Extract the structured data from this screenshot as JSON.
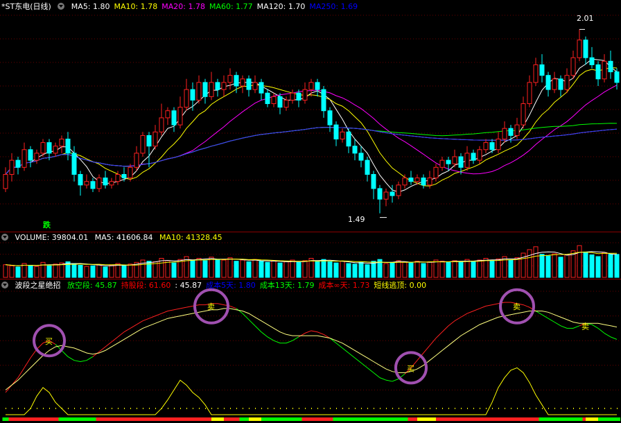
{
  "price_panel": {
    "stock_name": "*ST东电",
    "period": "(日线)",
    "ma_labels": [
      {
        "label": "MA5: 1.80",
        "color": "#ffffff"
      },
      {
        "label": "MA10: 1.78",
        "color": "#ffff00"
      },
      {
        "label": "MA20: 1.78",
        "color": "#ff00ff"
      },
      {
        "label": "MA60: 1.77",
        "color": "#00ff00"
      },
      {
        "label": "MA120: 1.70",
        "color": "#ffffff"
      },
      {
        "label": "MA250: 1.69",
        "color": "#0000ff"
      }
    ],
    "high_label": "2.01",
    "low_label": "1.49",
    "signal_label": "跌"
  },
  "volume_panel": {
    "title": "VOLUME: 39804.01",
    "ma5": "MA5: 41606.84",
    "ma10": "MA10: 41328.45"
  },
  "indicator_panel": {
    "title": "波段之星绝招",
    "items": [
      {
        "label": "放空段: 45.87",
        "color": "#00ff00"
      },
      {
        "label": "持股段: 61.60",
        "color": "#ff0000"
      },
      {
        "label": ": 45.87",
        "color": "#ffffff"
      },
      {
        "label": "成本5天: 1.80",
        "color": "#0000ff"
      },
      {
        "label": "成本13天: 1.79",
        "color": "#00ff00"
      },
      {
        "label": "成本∞天: 1.73",
        "color": "#ff0000"
      },
      {
        "label": "短线逃顶: 0.00",
        "color": "#ffff00"
      }
    ],
    "buy_label": "买",
    "sell_label": "卖"
  },
  "chart_data": {
    "type": "candlestick",
    "ylim": [
      1.45,
      2.05
    ],
    "candles": [
      [
        1.56,
        1.6,
        1.55,
        1.62
      ],
      [
        1.6,
        1.64,
        1.58,
        1.66
      ],
      [
        1.64,
        1.62,
        1.6,
        1.65
      ],
      [
        1.62,
        1.67,
        1.61,
        1.69
      ],
      [
        1.67,
        1.64,
        1.62,
        1.68
      ],
      [
        1.64,
        1.66,
        1.63,
        1.67
      ],
      [
        1.66,
        1.69,
        1.65,
        1.7
      ],
      [
        1.69,
        1.66,
        1.64,
        1.7
      ],
      [
        1.66,
        1.68,
        1.65,
        1.69
      ],
      [
        1.68,
        1.7,
        1.66,
        1.71
      ],
      [
        1.7,
        1.66,
        1.64,
        1.72
      ],
      [
        1.66,
        1.6,
        1.58,
        1.68
      ],
      [
        1.6,
        1.57,
        1.54,
        1.61
      ],
      [
        1.57,
        1.58,
        1.56,
        1.6
      ],
      [
        1.58,
        1.56,
        1.55,
        1.59
      ],
      [
        1.56,
        1.59,
        1.55,
        1.6
      ],
      [
        1.59,
        1.57,
        1.56,
        1.61
      ],
      [
        1.57,
        1.58,
        1.56,
        1.59
      ],
      [
        1.58,
        1.6,
        1.57,
        1.61
      ],
      [
        1.6,
        1.59,
        1.58,
        1.62
      ],
      [
        1.59,
        1.62,
        1.58,
        1.63
      ],
      [
        1.62,
        1.66,
        1.61,
        1.68
      ],
      [
        1.66,
        1.71,
        1.65,
        1.72
      ],
      [
        1.71,
        1.68,
        1.62,
        1.72
      ],
      [
        1.68,
        1.72,
        1.67,
        1.74
      ],
      [
        1.72,
        1.76,
        1.71,
        1.8
      ],
      [
        1.76,
        1.78,
        1.74,
        1.79
      ],
      [
        1.78,
        1.74,
        1.72,
        1.79
      ],
      [
        1.74,
        1.79,
        1.73,
        1.82
      ],
      [
        1.79,
        1.84,
        1.78,
        1.87
      ],
      [
        1.84,
        1.81,
        1.78,
        1.86
      ],
      [
        1.81,
        1.86,
        1.8,
        1.88
      ],
      [
        1.86,
        1.82,
        1.8,
        1.87
      ],
      [
        1.82,
        1.86,
        1.81,
        1.89
      ],
      [
        1.86,
        1.84,
        1.82,
        1.87
      ],
      [
        1.84,
        1.86,
        1.82,
        1.88
      ],
      [
        1.86,
        1.88,
        1.84,
        1.9
      ],
      [
        1.88,
        1.85,
        1.83,
        1.89
      ],
      [
        1.85,
        1.87,
        1.83,
        1.88
      ],
      [
        1.87,
        1.84,
        1.82,
        1.88
      ],
      [
        1.84,
        1.86,
        1.83,
        1.88
      ],
      [
        1.86,
        1.83,
        1.81,
        1.87
      ],
      [
        1.83,
        1.8,
        1.79,
        1.84
      ],
      [
        1.8,
        1.82,
        1.79,
        1.83
      ],
      [
        1.82,
        1.79,
        1.77,
        1.83
      ],
      [
        1.79,
        1.81,
        1.78,
        1.82
      ],
      [
        1.81,
        1.83,
        1.8,
        1.84
      ],
      [
        1.83,
        1.81,
        1.79,
        1.84
      ],
      [
        1.81,
        1.84,
        1.8,
        1.86
      ],
      [
        1.84,
        1.86,
        1.82,
        1.87
      ],
      [
        1.86,
        1.84,
        1.82,
        1.87
      ],
      [
        1.84,
        1.78,
        1.76,
        1.85
      ],
      [
        1.78,
        1.74,
        1.72,
        1.79
      ],
      [
        1.74,
        1.7,
        1.68,
        1.75
      ],
      [
        1.7,
        1.72,
        1.69,
        1.73
      ],
      [
        1.72,
        1.68,
        1.66,
        1.73
      ],
      [
        1.68,
        1.66,
        1.64,
        1.7
      ],
      [
        1.66,
        1.64,
        1.62,
        1.68
      ],
      [
        1.64,
        1.6,
        1.58,
        1.65
      ],
      [
        1.6,
        1.56,
        1.53,
        1.61
      ],
      [
        1.56,
        1.53,
        1.49,
        1.57
      ],
      [
        1.53,
        1.55,
        1.51,
        1.56
      ],
      [
        1.55,
        1.54,
        1.52,
        1.57
      ],
      [
        1.54,
        1.57,
        1.53,
        1.58
      ],
      [
        1.57,
        1.59,
        1.56,
        1.6
      ],
      [
        1.59,
        1.58,
        1.57,
        1.61
      ],
      [
        1.58,
        1.59,
        1.57,
        1.6
      ],
      [
        1.59,
        1.57,
        1.56,
        1.6
      ],
      [
        1.57,
        1.59,
        1.56,
        1.61
      ],
      [
        1.59,
        1.62,
        1.58,
        1.63
      ],
      [
        1.62,
        1.64,
        1.61,
        1.65
      ],
      [
        1.64,
        1.63,
        1.61,
        1.65
      ],
      [
        1.63,
        1.65,
        1.62,
        1.67
      ],
      [
        1.65,
        1.62,
        1.6,
        1.66
      ],
      [
        1.62,
        1.66,
        1.61,
        1.68
      ],
      [
        1.66,
        1.64,
        1.63,
        1.67
      ],
      [
        1.64,
        1.67,
        1.63,
        1.68
      ],
      [
        1.67,
        1.69,
        1.66,
        1.7
      ],
      [
        1.69,
        1.67,
        1.66,
        1.7
      ],
      [
        1.67,
        1.7,
        1.66,
        1.72
      ],
      [
        1.7,
        1.73,
        1.69,
        1.75
      ],
      [
        1.73,
        1.71,
        1.69,
        1.74
      ],
      [
        1.71,
        1.74,
        1.7,
        1.76
      ],
      [
        1.74,
        1.8,
        1.73,
        1.82
      ],
      [
        1.8,
        1.86,
        1.79,
        1.88
      ],
      [
        1.86,
        1.91,
        1.85,
        1.93
      ],
      [
        1.91,
        1.88,
        1.86,
        1.94
      ],
      [
        1.88,
        1.84,
        1.82,
        1.89
      ],
      [
        1.84,
        1.87,
        1.83,
        1.89
      ],
      [
        1.87,
        1.84,
        1.82,
        1.88
      ],
      [
        1.84,
        1.88,
        1.83,
        1.9
      ],
      [
        1.88,
        1.93,
        1.87,
        1.95
      ],
      [
        1.93,
        1.98,
        1.92,
        2.01
      ],
      [
        1.98,
        1.93,
        1.91,
        1.99
      ],
      [
        1.93,
        1.91,
        1.9,
        1.96
      ],
      [
        1.91,
        1.87,
        1.85,
        1.92
      ],
      [
        1.87,
        1.92,
        1.86,
        1.94
      ],
      [
        1.92,
        1.89,
        1.87,
        1.95
      ],
      [
        1.89,
        1.86,
        1.84,
        1.9
      ]
    ],
    "volume_ylim": [
      0,
      60000
    ],
    "volume": [
      22000,
      20000,
      18000,
      24000,
      21000,
      19000,
      26000,
      20000,
      23000,
      25000,
      27000,
      24000,
      21000,
      19000,
      20000,
      22000,
      18000,
      21000,
      24000,
      20000,
      23000,
      26000,
      30000,
      28000,
      27000,
      33000,
      29000,
      25000,
      31000,
      36000,
      30000,
      33000,
      29000,
      35000,
      31000,
      30000,
      34000,
      28000,
      30000,
      27000,
      31000,
      28000,
      26000,
      29000,
      25000,
      27000,
      30000,
      26000,
      29000,
      33000,
      28000,
      31000,
      27000,
      25000,
      28000,
      24000,
      23000,
      26000,
      22000,
      28000,
      31000,
      24000,
      26000,
      29000,
      27000,
      25000,
      28000,
      24000,
      27000,
      30000,
      28000,
      26000,
      29000,
      27000,
      31000,
      28000,
      30000,
      33000,
      29000,
      32000,
      36000,
      30000,
      34000,
      42000,
      48000,
      53000,
      40000,
      37000,
      41000,
      35000,
      39000,
      46000,
      55000,
      44000,
      39000,
      36000,
      43000,
      40000,
      39804
    ],
    "indicator": {
      "ylim": [
        0,
        100
      ],
      "main": [
        18,
        24,
        30,
        38,
        46,
        53,
        58,
        60,
        57,
        52,
        47,
        44,
        43,
        44,
        47,
        51,
        55,
        59,
        63,
        67,
        70,
        73,
        76,
        78,
        80,
        82,
        84,
        85,
        86,
        87,
        88,
        89,
        89,
        90,
        90,
        89,
        88,
        86,
        82,
        77,
        72,
        67,
        63,
        60,
        58,
        58,
        60,
        63,
        66,
        68,
        67,
        65,
        62,
        58,
        54,
        50,
        46,
        42,
        38,
        34,
        30,
        28,
        27,
        29,
        33,
        38,
        44,
        50,
        56,
        62,
        67,
        72,
        76,
        79,
        82,
        84,
        86,
        88,
        89,
        90,
        91,
        91,
        90,
        89,
        87,
        84,
        81,
        78,
        75,
        72,
        70,
        70,
        72,
        74,
        73,
        70,
        66,
        63,
        61
      ],
      "sub": [
        20,
        24,
        28,
        33,
        38,
        43,
        48,
        52,
        55,
        56,
        55,
        54,
        52,
        50,
        49,
        50,
        52,
        55,
        58,
        61,
        64,
        67,
        70,
        72,
        74,
        76,
        78,
        79,
        80,
        81,
        82,
        83,
        84,
        85,
        85,
        86,
        86,
        85,
        84,
        82,
        79,
        76,
        73,
        70,
        67,
        65,
        64,
        64,
        64,
        64,
        64,
        63,
        62,
        60,
        58,
        55,
        52,
        49,
        46,
        43,
        40,
        37,
        35,
        34,
        34,
        35,
        37,
        40,
        44,
        48,
        52,
        56,
        60,
        64,
        67,
        70,
        73,
        75,
        77,
        79,
        80,
        81,
        82,
        83,
        84,
        84,
        84,
        83,
        81,
        79,
        77,
        75,
        74,
        74,
        74,
        74,
        73,
        72,
        71
      ],
      "yellow": [
        0,
        0,
        0,
        0,
        5,
        15,
        22,
        18,
        10,
        5,
        0,
        0,
        0,
        0,
        0,
        0,
        0,
        0,
        0,
        0,
        0,
        0,
        0,
        0,
        0,
        5,
        12,
        20,
        28,
        24,
        18,
        14,
        8,
        0,
        0,
        0,
        0,
        0,
        0,
        0,
        0,
        0,
        0,
        0,
        0,
        0,
        0,
        0,
        0,
        0,
        0,
        0,
        0,
        0,
        0,
        0,
        0,
        0,
        0,
        0,
        0,
        0,
        0,
        0,
        0,
        0,
        0,
        0,
        0,
        0,
        0,
        0,
        0,
        0,
        0,
        0,
        0,
        0,
        10,
        22,
        30,
        36,
        38,
        34,
        26,
        16,
        8,
        0,
        0,
        0,
        0,
        0,
        0,
        0,
        0,
        0,
        0,
        0,
        0
      ],
      "buy_index": [
        7,
        65
      ],
      "sell_index": [
        33,
        82,
        93
      ]
    }
  },
  "colors": {
    "up": "#ff2020",
    "down": "#00ffff",
    "bg": "#000000",
    "separator": "#8b0000",
    "circle": "#a050b0"
  }
}
